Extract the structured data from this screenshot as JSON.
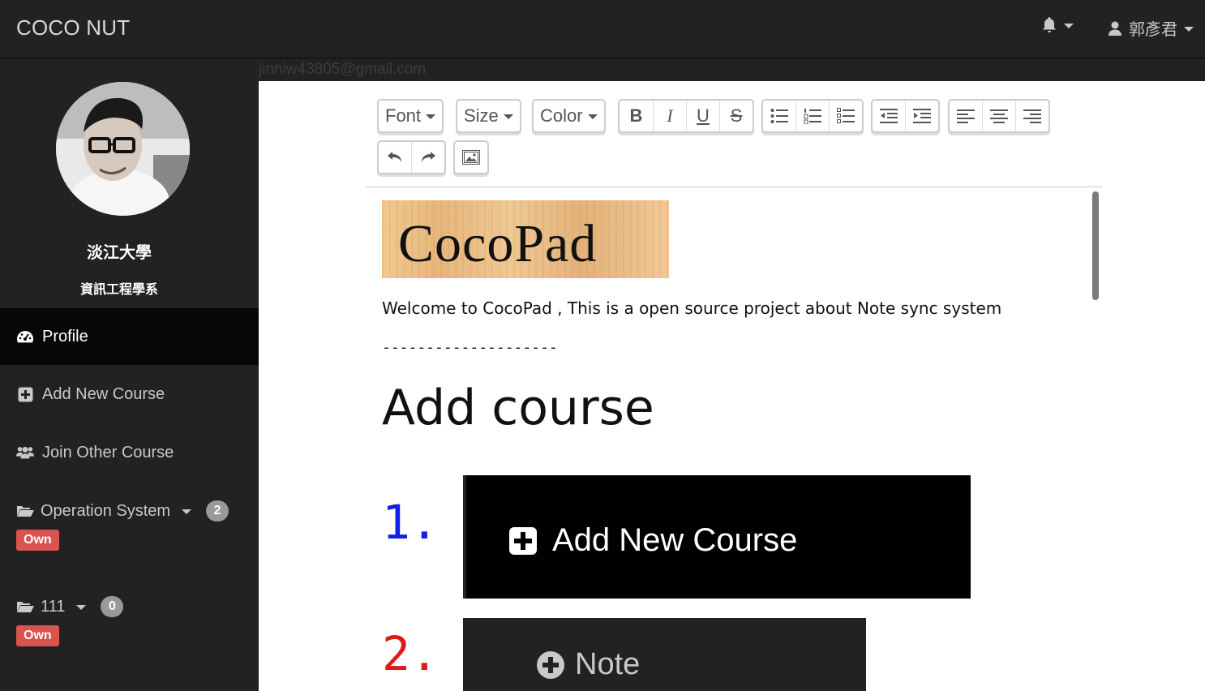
{
  "navbar": {
    "brand": "COCO NUT",
    "user_name": "郭彥君"
  },
  "subbar": {
    "email": "jinniw43805@gmail.com"
  },
  "sidebar": {
    "school": "淡江大學",
    "department": "資訊工程學系",
    "items": [
      {
        "label": "Profile",
        "icon": "dashboard-icon",
        "active": true
      },
      {
        "label": "Add New Course",
        "icon": "plus-square-icon"
      },
      {
        "label": "Join Other Course",
        "icon": "users-icon"
      }
    ],
    "courses": [
      {
        "name": "Operation System",
        "count": "2",
        "tag": "Own"
      },
      {
        "name": "111",
        "count": "0",
        "tag": "Own"
      }
    ]
  },
  "toolbar": {
    "font": "Font",
    "size": "Size",
    "color": "Color"
  },
  "editor": {
    "logo_text": "CocoPad",
    "welcome": "Welcome to CocoPad , This is a open source project about Note sync system",
    "dashes": "--------------------",
    "heading": "Add course",
    "step1_num": "1.",
    "step1_label": "Add New Course",
    "step2_num": "2.",
    "step2_label": "Note"
  },
  "colors": {
    "dark": "#222222",
    "active": "#080808",
    "badge": "#999999",
    "own": "#d9534f",
    "step1": "#1022e8",
    "step2": "#e01818"
  }
}
